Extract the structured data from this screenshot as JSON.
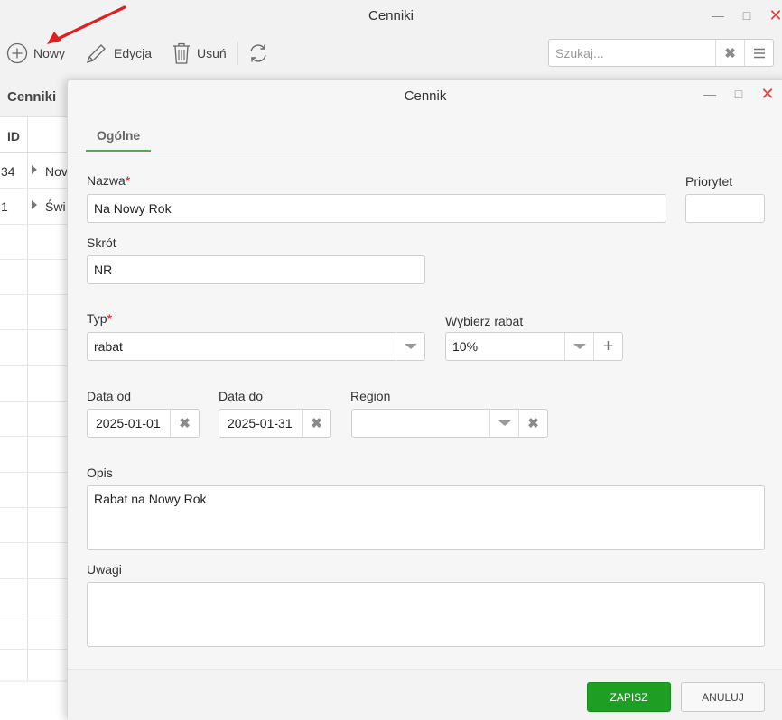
{
  "window": {
    "title": "Cenniki"
  },
  "toolbar": {
    "new_label": "Nowy",
    "edit_label": "Edycja",
    "delete_label": "Usuń",
    "search_placeholder": "Szukaj..."
  },
  "list": {
    "tab_label": "Cenniki",
    "columns": [
      "ID"
    ],
    "rows": [
      {
        "id": "34",
        "name": "Nov"
      },
      {
        "id": "1",
        "name": "Świ"
      }
    ]
  },
  "dialog": {
    "title": "Cennik",
    "tab": "Ogólne",
    "fields": {
      "nazwa_label": "Nazwa",
      "nazwa_value": "Na Nowy Rok",
      "priorytet_label": "Priorytet",
      "priorytet_value": "",
      "skrot_label": "Skrót",
      "skrot_value": "NR",
      "typ_label": "Typ",
      "typ_value": "rabat",
      "rabat_label": "Wybierz rabat",
      "rabat_value": "10%",
      "data_od_label": "Data od",
      "data_od_value": "2025-01-01",
      "data_do_label": "Data do",
      "data_do_value": "2025-01-31",
      "region_label": "Region",
      "region_value": "",
      "opis_label": "Opis",
      "opis_value": "Rabat na Nowy Rok",
      "uwagi_label": "Uwagi",
      "uwagi_value": ""
    },
    "required_marker": "*",
    "buttons": {
      "save": "ZAPISZ",
      "cancel": "ANULUJ"
    }
  },
  "colors": {
    "accent_green": "#1e9e22",
    "tab_underline": "#4caf50",
    "required_red": "#e53935",
    "arrow_red": "#e02020"
  }
}
